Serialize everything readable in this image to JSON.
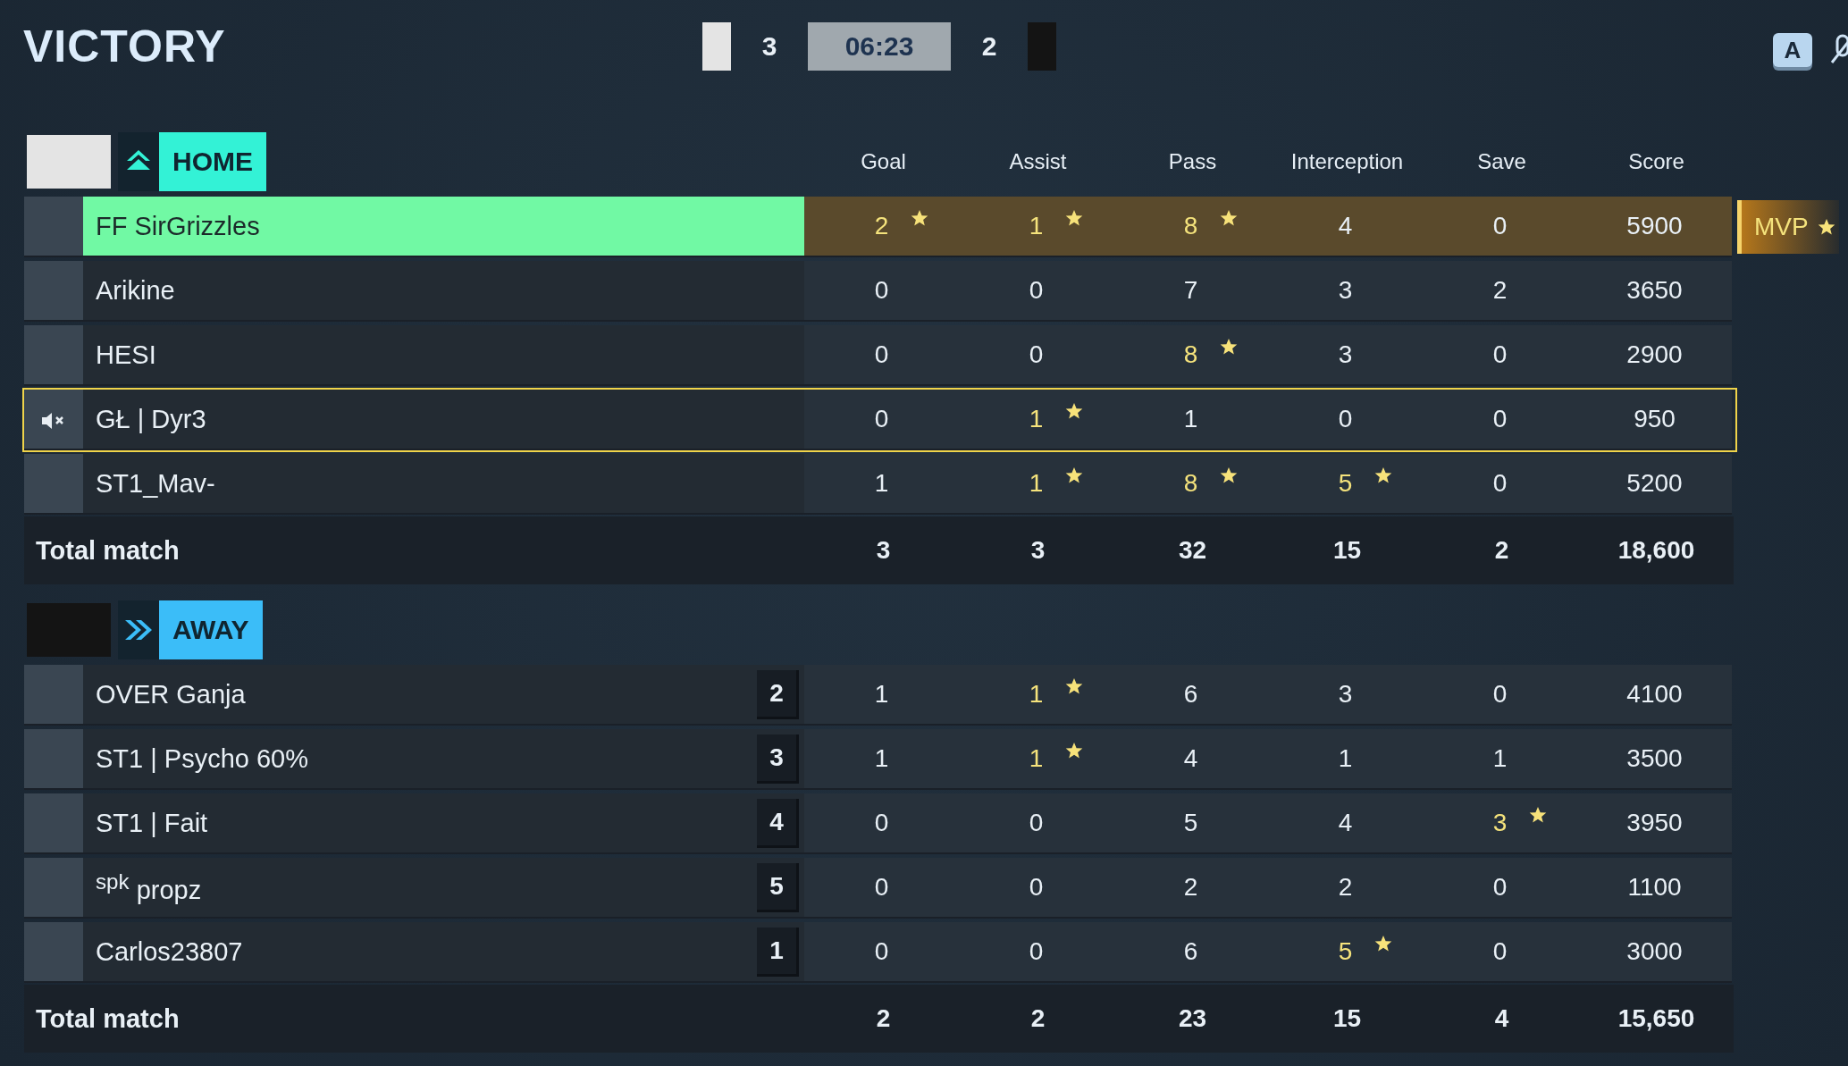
{
  "result": "VICTORY",
  "scoreboard": {
    "home_score": "3",
    "time": "06:23",
    "away_score": "2"
  },
  "key_hint": "A",
  "mvp_label": "MVP",
  "teams": [
    {
      "label": "HOME",
      "kind": "home",
      "color": "#33f2d6",
      "columns": [
        "Goal",
        "Assist",
        "Pass",
        "Interception",
        "Save",
        "Score"
      ],
      "players": [
        {
          "name": "FF SirGrizzles",
          "highlighted": true,
          "mvp": true,
          "muted": false,
          "focused": false,
          "stats": [
            {
              "value": "2",
              "star": true
            },
            {
              "value": "1",
              "star": true
            },
            {
              "value": "8",
              "star": true
            },
            {
              "value": "4",
              "star": false
            },
            {
              "value": "0",
              "star": false
            },
            {
              "value": "5900",
              "star": false
            }
          ]
        },
        {
          "name": "Arikine",
          "highlighted": false,
          "mvp": false,
          "muted": false,
          "focused": false,
          "stats": [
            {
              "value": "0",
              "star": false
            },
            {
              "value": "0",
              "star": false
            },
            {
              "value": "7",
              "star": false
            },
            {
              "value": "3",
              "star": false
            },
            {
              "value": "2",
              "star": false
            },
            {
              "value": "3650",
              "star": false
            }
          ]
        },
        {
          "name": "HESI",
          "highlighted": false,
          "mvp": false,
          "muted": false,
          "focused": false,
          "stats": [
            {
              "value": "0",
              "star": false
            },
            {
              "value": "0",
              "star": false
            },
            {
              "value": "8",
              "star": true
            },
            {
              "value": "3",
              "star": false
            },
            {
              "value": "0",
              "star": false
            },
            {
              "value": "2900",
              "star": false
            }
          ]
        },
        {
          "name": "GŁ | Dyr3",
          "highlighted": false,
          "mvp": false,
          "muted": true,
          "focused": true,
          "stats": [
            {
              "value": "0",
              "star": false
            },
            {
              "value": "1",
              "star": true
            },
            {
              "value": "1",
              "star": false
            },
            {
              "value": "0",
              "star": false
            },
            {
              "value": "0",
              "star": false
            },
            {
              "value": "950",
              "star": false
            }
          ]
        },
        {
          "name": "ST1_Mav-",
          "highlighted": false,
          "mvp": false,
          "muted": false,
          "focused": false,
          "stats": [
            {
              "value": "1",
              "star": false
            },
            {
              "value": "1",
              "star": true
            },
            {
              "value": "8",
              "star": true
            },
            {
              "value": "5",
              "star": true
            },
            {
              "value": "0",
              "star": false
            },
            {
              "value": "5200",
              "star": false
            }
          ]
        }
      ],
      "total_label": "Total match",
      "totals": [
        "3",
        "3",
        "32",
        "15",
        "2",
        "18,600"
      ]
    },
    {
      "label": "AWAY",
      "kind": "away",
      "color": "#3bbdf8",
      "players": [
        {
          "name": "OVER Ganja",
          "badge": "2",
          "highlighted": false,
          "mvp": false,
          "muted": false,
          "focused": false,
          "stats": [
            {
              "value": "1",
              "star": false
            },
            {
              "value": "1",
              "star": true
            },
            {
              "value": "6",
              "star": false
            },
            {
              "value": "3",
              "star": false
            },
            {
              "value": "0",
              "star": false
            },
            {
              "value": "4100",
              "star": false
            }
          ]
        },
        {
          "name": "ST1 | Psycho 60%",
          "badge": "3",
          "highlighted": false,
          "mvp": false,
          "muted": false,
          "focused": false,
          "stats": [
            {
              "value": "1",
              "star": false
            },
            {
              "value": "1",
              "star": true
            },
            {
              "value": "4",
              "star": false
            },
            {
              "value": "1",
              "star": false
            },
            {
              "value": "1",
              "star": false
            },
            {
              "value": "3500",
              "star": false
            }
          ]
        },
        {
          "name": "ST1 | Fait",
          "badge": "4",
          "highlighted": false,
          "mvp": false,
          "muted": false,
          "focused": false,
          "stats": [
            {
              "value": "0",
              "star": false
            },
            {
              "value": "0",
              "star": false
            },
            {
              "value": "5",
              "star": false
            },
            {
              "value": "4",
              "star": false
            },
            {
              "value": "3",
              "star": true
            },
            {
              "value": "3950",
              "star": false
            }
          ]
        },
        {
          "name": "$^{spk}$ propz",
          "badge": "5",
          "highlighted": false,
          "mvp": false,
          "muted": false,
          "focused": false,
          "stats": [
            {
              "value": "0",
              "star": false
            },
            {
              "value": "0",
              "star": false
            },
            {
              "value": "2",
              "star": false
            },
            {
              "value": "2",
              "star": false
            },
            {
              "value": "0",
              "star": false
            },
            {
              "value": "1100",
              "star": false
            }
          ]
        },
        {
          "name": "Carlos23807",
          "badge": "1",
          "highlighted": false,
          "mvp": false,
          "muted": false,
          "focused": false,
          "stats": [
            {
              "value": "0",
              "star": false
            },
            {
              "value": "0",
              "star": false
            },
            {
              "value": "6",
              "star": false
            },
            {
              "value": "5",
              "star": true
            },
            {
              "value": "0",
              "star": false
            },
            {
              "value": "3000",
              "star": false
            }
          ]
        }
      ],
      "total_label": "Total match",
      "totals": [
        "2",
        "2",
        "23",
        "15",
        "4",
        "15,650"
      ]
    }
  ]
}
